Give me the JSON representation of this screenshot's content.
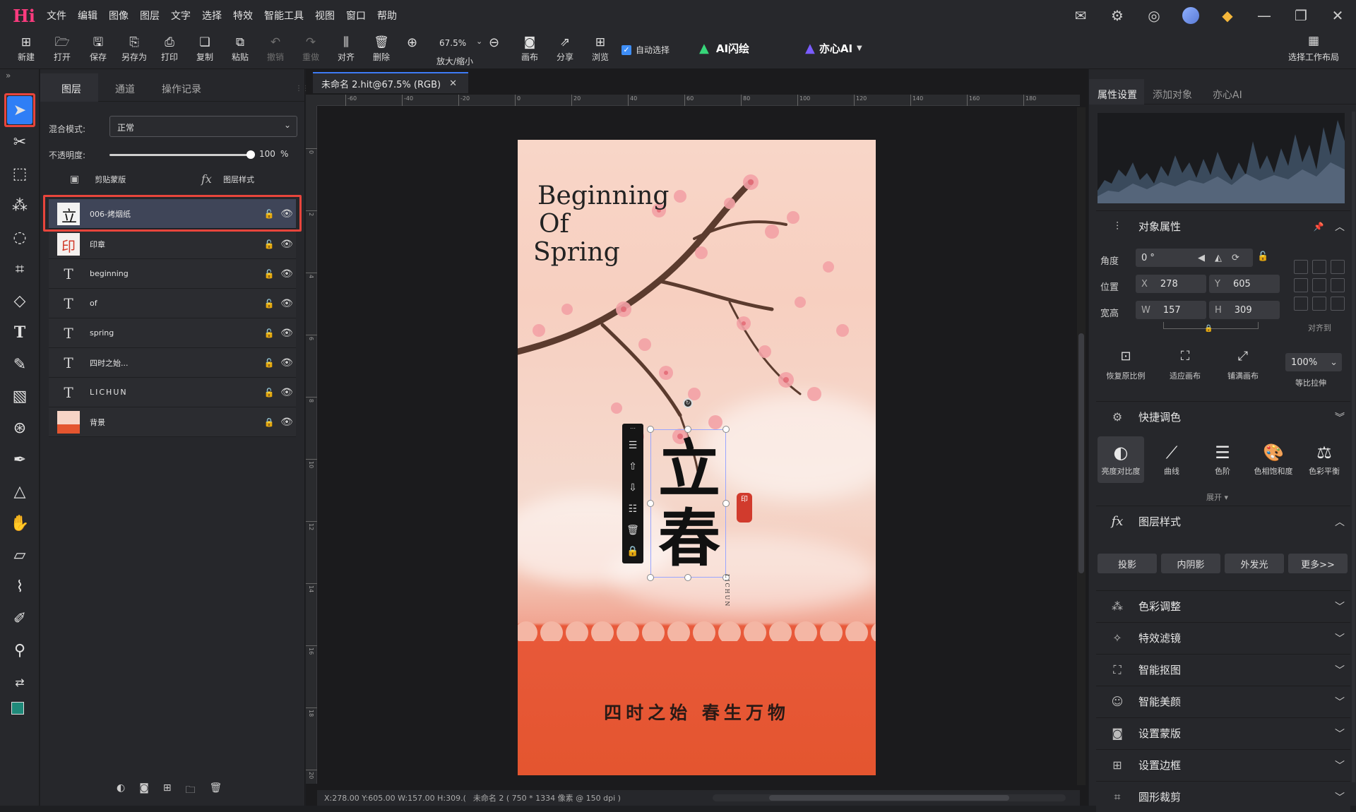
{
  "app": {
    "logo": "Hi",
    "menu": [
      "文件",
      "编辑",
      "图像",
      "图层",
      "文字",
      "选择",
      "特效",
      "智能工具",
      "视图",
      "窗口",
      "帮助"
    ]
  },
  "toolbar": {
    "buttons": [
      {
        "label": "新建",
        "icon": "new-icon"
      },
      {
        "label": "打开",
        "icon": "open-folder-icon"
      },
      {
        "label": "保存",
        "icon": "save-icon"
      },
      {
        "label": "另存为",
        "icon": "save-as-icon"
      },
      {
        "label": "打印",
        "icon": "print-icon"
      },
      {
        "label": "复制",
        "icon": "copy-icon"
      },
      {
        "label": "粘贴",
        "icon": "paste-icon"
      },
      {
        "label": "撤销",
        "icon": "undo-icon"
      },
      {
        "label": "重做",
        "icon": "redo-icon"
      },
      {
        "label": "对齐",
        "icon": "align-icon"
      },
      {
        "label": "删除",
        "icon": "trash-icon"
      }
    ],
    "zoom_label": "放大/缩小",
    "zoom_value": "67.5%",
    "canvas_label": "画布",
    "share_label": "分享",
    "browse_label": "浏览",
    "auto_select": "自动选择",
    "ai_flash": "AI闪绘",
    "yixin_ai": "亦心AI",
    "workspace": "选择工作布局"
  },
  "layers_panel": {
    "tabs": [
      "图层",
      "通道",
      "操作记录"
    ],
    "blend_label": "混合模式:",
    "blend_value": "正常",
    "opacity_label": "不透明度:",
    "opacity_value": "100",
    "opacity_unit": "%",
    "opacity_fraction": 1.0,
    "clip_mask": "剪贴蒙版",
    "layer_style": "图层样式",
    "layers": [
      {
        "name": "006-烤烟纸",
        "type": "image",
        "selected": true
      },
      {
        "name": "印章",
        "type": "image"
      },
      {
        "name": "beginning",
        "type": "text"
      },
      {
        "name": "of",
        "type": "text"
      },
      {
        "name": "spring",
        "type": "text"
      },
      {
        "name": "四时之始...",
        "type": "text"
      },
      {
        "name": "LICHUN",
        "type": "text"
      },
      {
        "name": "背景",
        "type": "image",
        "locked": true
      }
    ]
  },
  "document": {
    "tab_title": "未命名 2.hit@67.5% (RGB)",
    "ruler_h": [
      "-60",
      "-40",
      "-20",
      "0",
      "20",
      "40",
      "60",
      "80",
      "100",
      "120",
      "140",
      "160",
      "180"
    ],
    "ruler_v": [
      "0",
      "2",
      "4",
      "6",
      "8",
      "10",
      "12",
      "14",
      "16",
      "18",
      "20"
    ],
    "poster_title_lines": [
      "Beginning",
      "Of",
      "Spring"
    ],
    "poster_calligraphy": "立春",
    "poster_vertical_text": "LICHUN",
    "poster_subtitle": "四时之始 春生万物",
    "status_coords": "X:278.00 Y:605.00 W:157.00 H:309.(",
    "status_doc": "未命名 2 ( 750 * 1334 像素 @ 150 dpi )"
  },
  "right_panel": {
    "tabs": [
      "属性设置",
      "添加对象",
      "亦心AI"
    ],
    "object_props": "对象属性",
    "angle_label": "角度",
    "angle_value": "0 °",
    "pos_label": "位置",
    "x_label": "X",
    "x_value": "278",
    "y_label": "Y",
    "y_value": "605",
    "size_label": "宽高",
    "w_label": "W",
    "w_value": "157",
    "h_label": "H",
    "h_value": "309",
    "align_to": "对齐到",
    "fit_buttons": [
      "恢复原比例",
      "适应画布",
      "铺满画布"
    ],
    "scale_value": "100%",
    "scale_label": "等比拉伸",
    "quick_color": "快捷调色",
    "quick_buttons": [
      "亮度对比度",
      "曲线",
      "色阶",
      "色相饱和度",
      "色彩平衡"
    ],
    "expand": "展开",
    "layer_style": "图层样式",
    "style_buttons": [
      "投影",
      "内阴影",
      "外发光",
      "更多>>"
    ],
    "sections": [
      "色彩调整",
      "特效滤镜",
      "智能抠图",
      "智能美颜",
      "设置蒙版",
      "设置边框",
      "圆形裁剪"
    ]
  }
}
